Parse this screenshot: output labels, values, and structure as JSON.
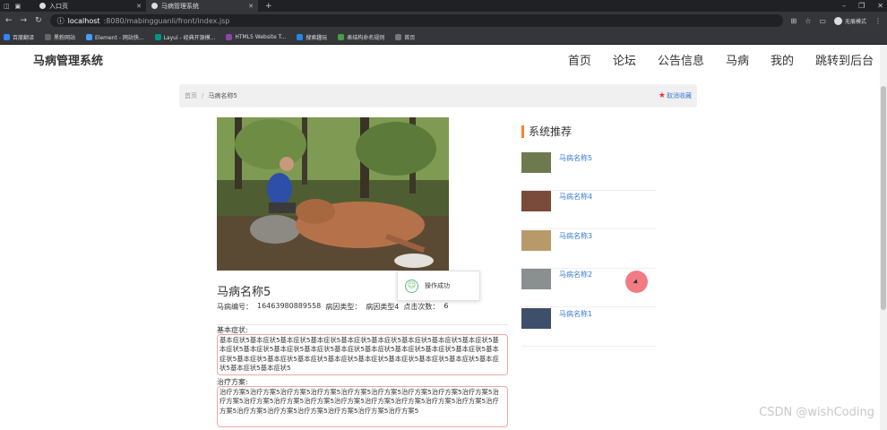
{
  "browser": {
    "tabs": [
      {
        "title": "入口页",
        "active": false
      },
      {
        "title": "马病管理系统",
        "active": true
      }
    ],
    "new_tab": "+",
    "url_host": "localhost",
    "url_rest": ":8080/mabingguanli/front/index.jsp",
    "profile_label": "无痕模式",
    "bookmarks": [
      {
        "label": "百度翻译",
        "color": "#3385ff"
      },
      {
        "label": "黑粉网站",
        "color": "#666666"
      },
      {
        "label": "Element - 网站快...",
        "color": "#409eff"
      },
      {
        "label": "Layui - 经典开源模...",
        "color": "#009688"
      },
      {
        "label": "HTML5 Website T...",
        "color": "#8e44ad"
      },
      {
        "label": "搜索趣玩",
        "color": "#1e88e5"
      },
      {
        "label": "表结构命名规则",
        "color": "#43a047"
      },
      {
        "label": "首页",
        "color": "#777777"
      }
    ]
  },
  "site": {
    "logo": "马病管理系统",
    "nav": [
      "首页",
      "论坛",
      "公告信息",
      "马病",
      "我的",
      "跳转到后台"
    ]
  },
  "breadcrumb": {
    "home": "首页",
    "separator": "/",
    "current": "马病名称5",
    "unfavorite": "取消收藏"
  },
  "detail": {
    "title": "马病名称5",
    "meta": [
      "马病编号：",
      "16463980889558",
      "病因类型：",
      "病因类型4",
      "点击次数：",
      "6"
    ],
    "symptom_label": "基本症状:",
    "symptom_text": "基本症状5基本症状5基本症状5基本症状5基本症状5基本症状5基本症状5基本症状5基本症状5基本症状5基本症状5基本症状5基本症状5基本症状5基本症状5基本症状5基本症状5基本症状5基本症状5基本症状5基本症状5基本症状5基本症状5基本症状5基本症状5基本症状5基本症状5基本症状5基本症状5基本症状5",
    "treatment_label": "治疗方案:",
    "treatment_text": "治疗方案5治疗方案5治疗方案5治疗方案5治疗方案5治疗方案5治疗方案5治疗方案5治疗方案5治疗方案5治疗方案5治疗方案5治疗方案5治疗方案5治疗方案5治疗方案5治疗方案5治疗方案5治疗方案5治疗方案5治疗方案5治疗方案5治疗方案5治疗方案5治疗方案5"
  },
  "toast": {
    "message": "操作成功",
    "icon": "smile-icon"
  },
  "recommend": {
    "heading": "系统推荐",
    "items": [
      {
        "name": "马病名称5",
        "thumb_color": "#6d7a4f"
      },
      {
        "name": "马病名称4",
        "thumb_color": "#7a4a3a"
      },
      {
        "name": "马病名称3",
        "thumb_color": "#b89a6a"
      },
      {
        "name": "马病名称2",
        "thumb_color": "#8a8f90"
      },
      {
        "name": "马病名称1",
        "thumb_color": "#3d4f6a"
      }
    ]
  },
  "watermark": "CSDN @wishCoding"
}
